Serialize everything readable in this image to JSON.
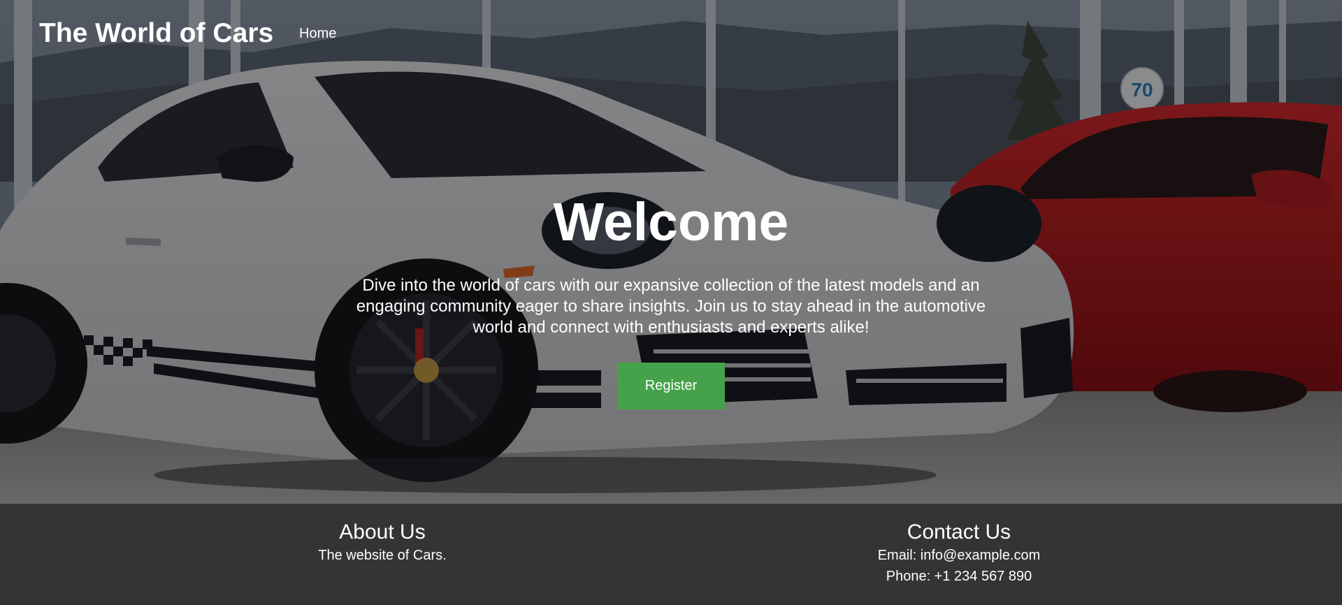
{
  "header": {
    "site_title": "The World of Cars",
    "nav": [
      {
        "label": "Home"
      }
    ]
  },
  "hero": {
    "title": "Welcome",
    "description": "Dive into the world of cars with our expansive collection of the latest models and an engaging community eager to share insights. Join us to stay ahead in the automotive world and connect with enthusiasts and experts alike!",
    "register_label": "Register",
    "register_color": "#46a24a",
    "showroom_sign": "70"
  },
  "footer": {
    "about": {
      "heading": "About Us",
      "text": "The website of Cars."
    },
    "contact": {
      "heading": "Contact Us",
      "email": "Email: info@example.com",
      "phone": "Phone: +1 234 567 890"
    },
    "background_color": "#343434"
  }
}
